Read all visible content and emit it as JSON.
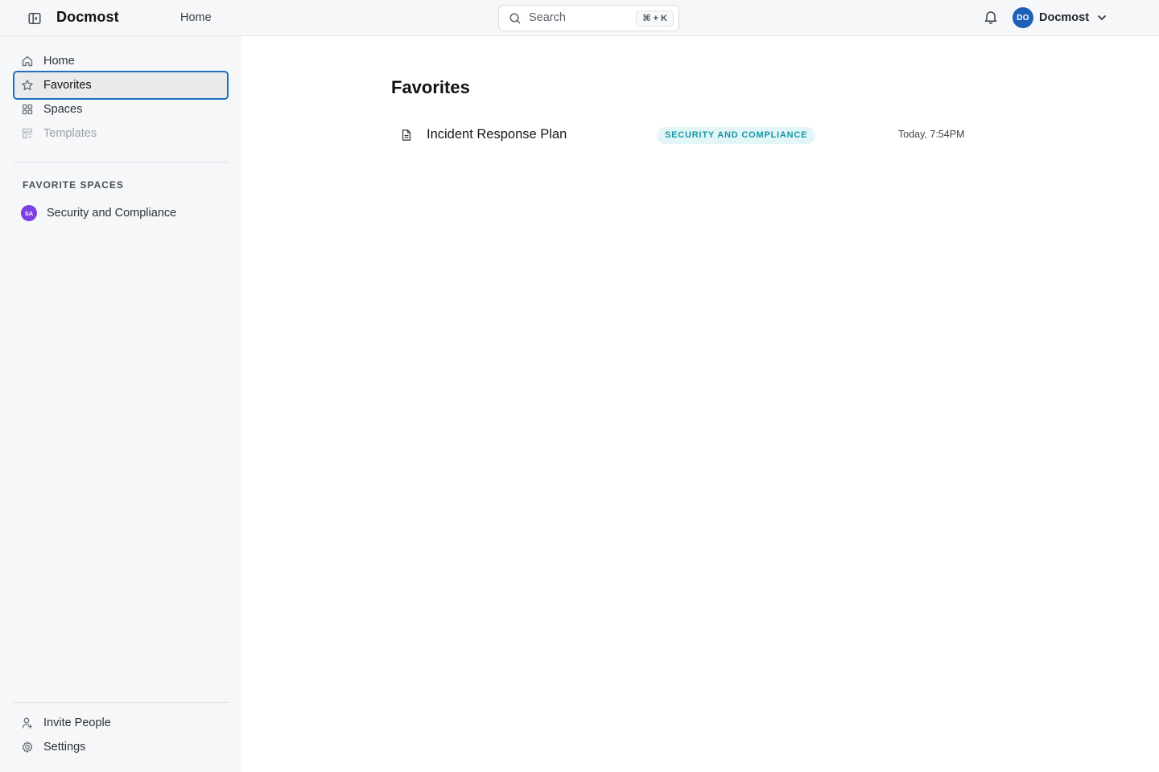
{
  "header": {
    "brand": "Docmost",
    "home_link": "Home",
    "search": {
      "placeholder": "Search",
      "shortcut": "⌘ + K"
    },
    "user": {
      "initials": "DO",
      "name": "Docmost",
      "avatar_color": "#1e5fb8"
    }
  },
  "sidebar": {
    "nav": [
      {
        "label": "Home",
        "icon": "home-icon",
        "state": "normal"
      },
      {
        "label": "Favorites",
        "icon": "star-icon",
        "state": "active"
      },
      {
        "label": "Spaces",
        "icon": "grid-icon",
        "state": "normal"
      },
      {
        "label": "Templates",
        "icon": "template-icon",
        "state": "disabled"
      }
    ],
    "favorite_spaces_title": "FAVORITE SPACES",
    "favorite_spaces": [
      {
        "initials": "SA",
        "label": "Security and Compliance",
        "avatar_color": "#7b3fe4"
      }
    ],
    "footer": [
      {
        "label": "Invite People",
        "icon": "user-plus-icon"
      },
      {
        "label": "Settings",
        "icon": "gear-icon"
      }
    ]
  },
  "main": {
    "title": "Favorites",
    "items": [
      {
        "title": "Incident Response Plan",
        "space": "SECURITY AND COMPLIANCE",
        "date": "Today, 7:54PM",
        "icon": "document-icon"
      }
    ]
  },
  "colors": {
    "active_outline": "#1f6fbf",
    "badge_bg": "#e3f6f7",
    "badge_text": "#1797a6"
  }
}
